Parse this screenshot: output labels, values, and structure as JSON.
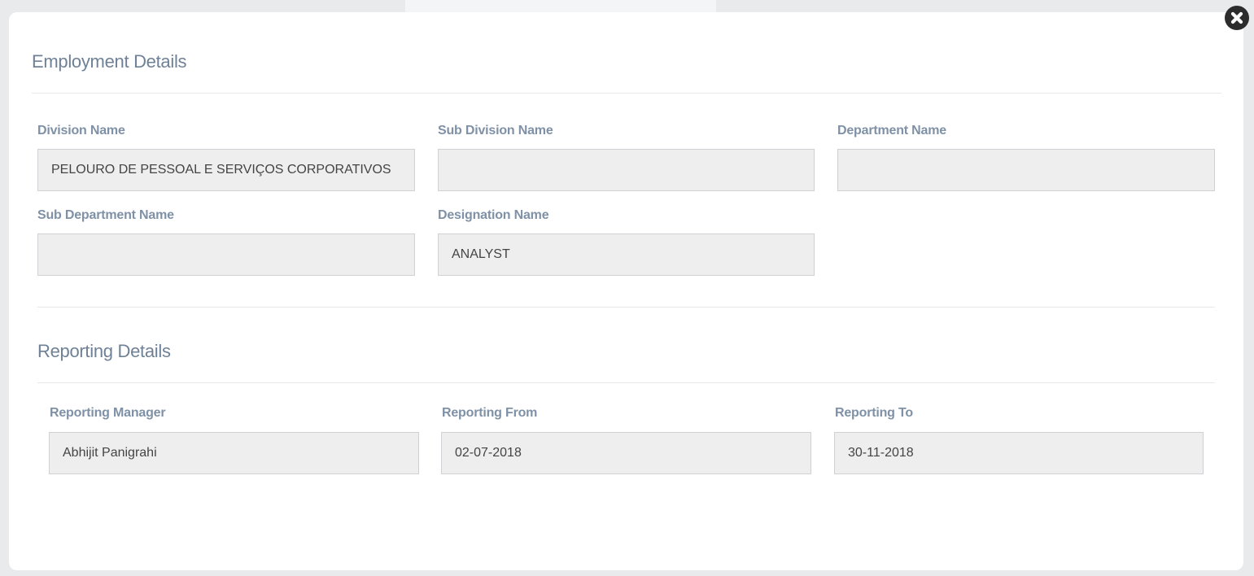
{
  "close_icon": "close-circle-icon",
  "employment": {
    "title": "Employment Details",
    "division_label": "Division Name",
    "division_value": "PELOURO DE PESSOAL E SERVIÇOS CORPORATIVOS",
    "subdivision_label": "Sub Division Name",
    "subdivision_value": "",
    "department_label": "Department Name",
    "department_value": "",
    "subdepartment_label": "Sub Department Name",
    "subdepartment_value": "",
    "designation_label": "Designation Name",
    "designation_value": "ANALYST"
  },
  "reporting": {
    "title": "Reporting Details",
    "manager_label": "Reporting Manager",
    "manager_value": "Abhijit Panigrahi",
    "from_label": "Reporting From",
    "from_value": "02-07-2018",
    "to_label": "Reporting To",
    "to_value": "30-11-2018"
  },
  "colors": {
    "title": "#6f8197",
    "label": "#7f91a6",
    "input_bg": "#eeeeee",
    "close_bg": "#2c2c2c"
  }
}
